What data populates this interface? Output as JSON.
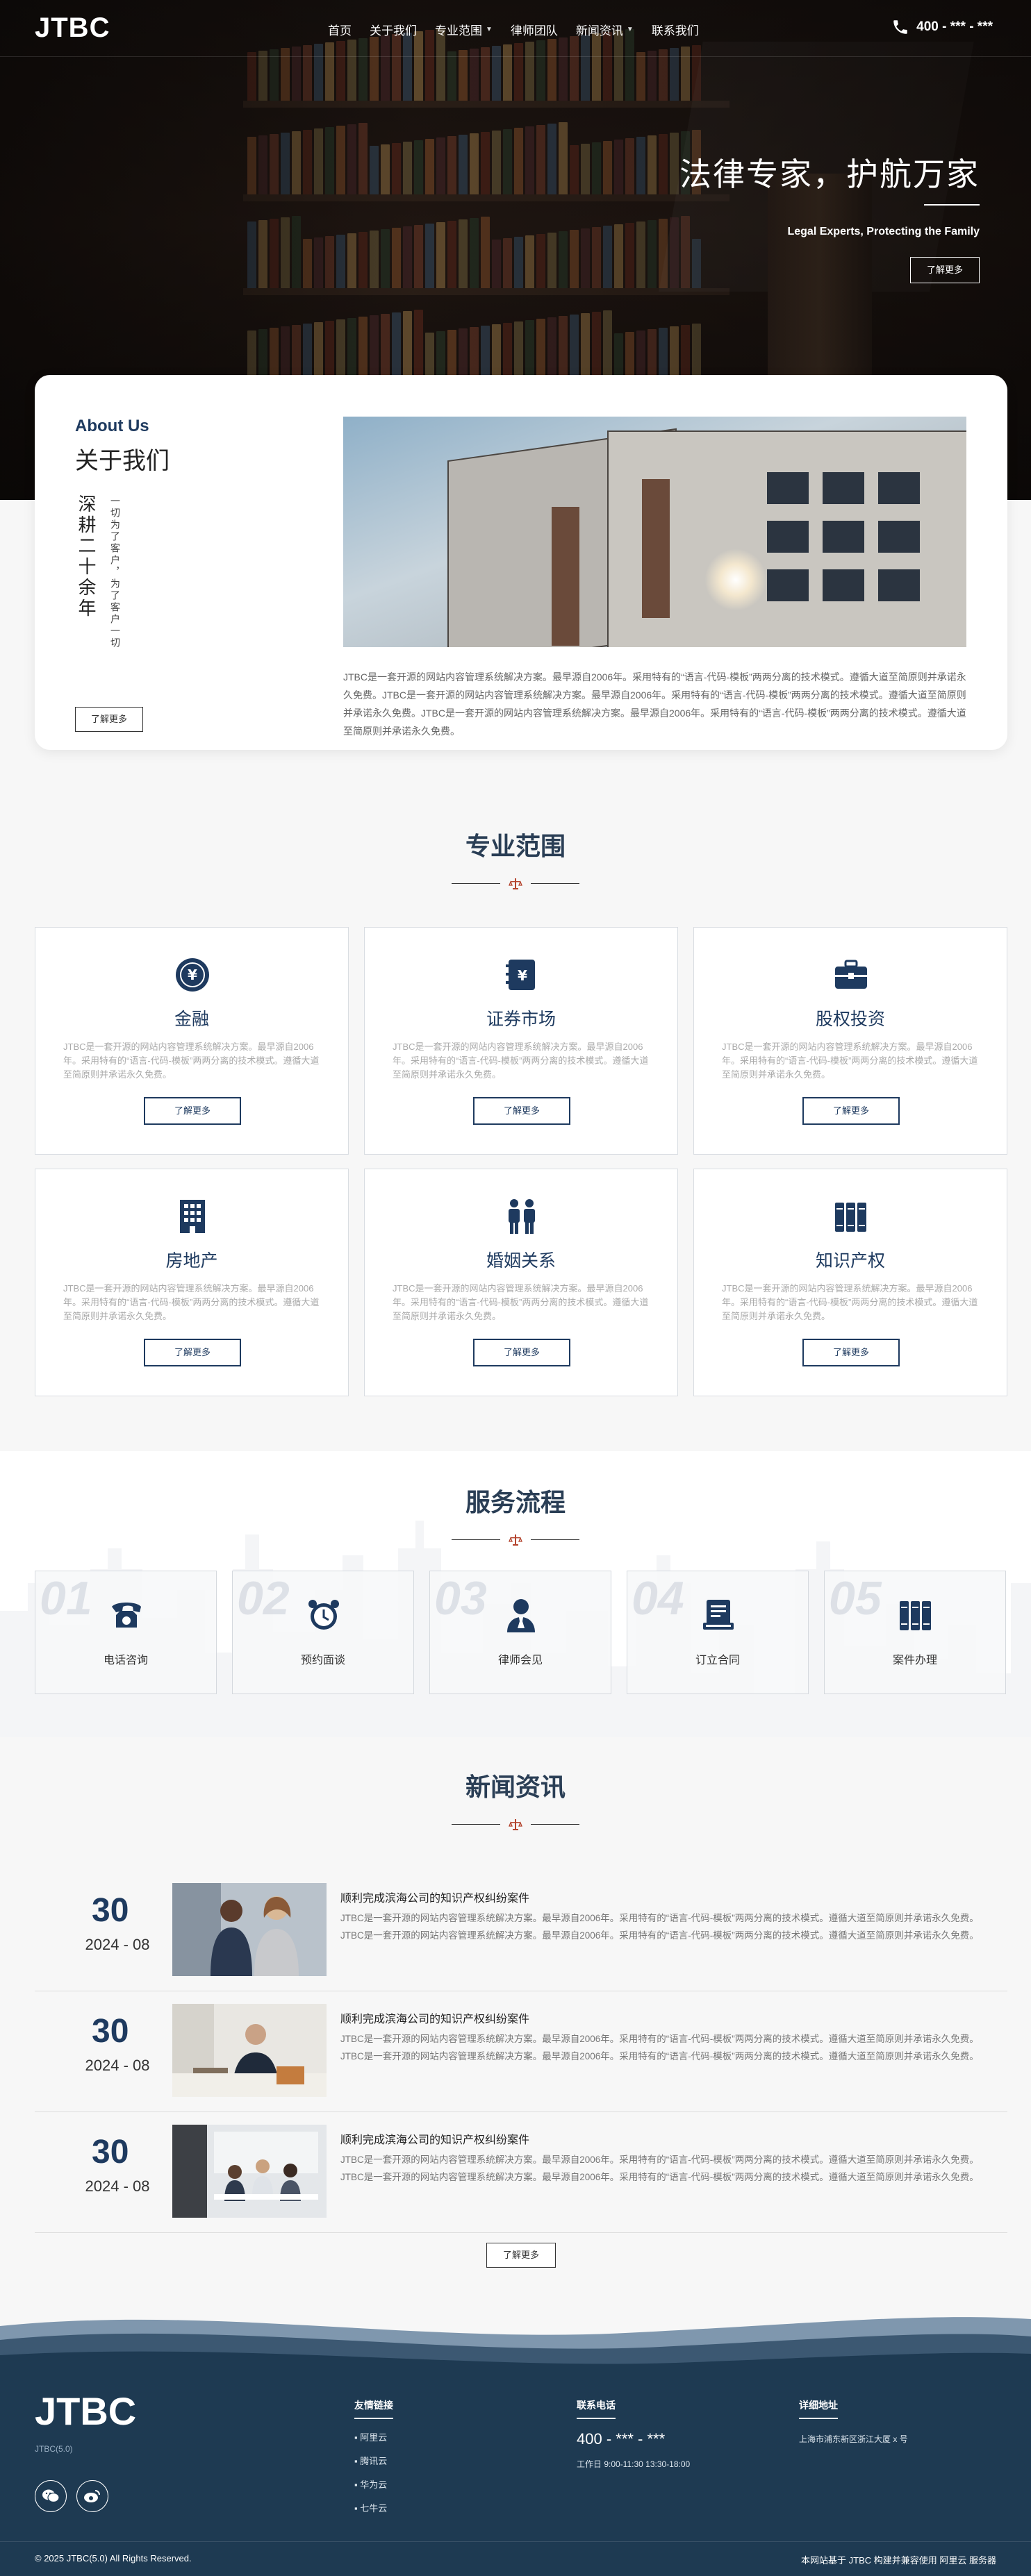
{
  "nav": {
    "logo": "JTBC",
    "items": [
      {
        "label": "首页"
      },
      {
        "label": "关于我们"
      },
      {
        "label": "专业范围"
      },
      {
        "label": "律师团队"
      },
      {
        "label": "新闻资讯"
      },
      {
        "label": "联系我们"
      }
    ],
    "phone": "400 - *** - ***"
  },
  "hero": {
    "title": "法律专家，护航万家",
    "subtitle": "Legal Experts, Protecting the Family",
    "button": "了解更多"
  },
  "about": {
    "en": "About Us",
    "cn": "关于我们",
    "vertical_big": "深耕二十余年",
    "vertical_small": "一切为了客户，为了客户一切",
    "button": "了解更多",
    "text": "JTBC是一套开源的网站内容管理系统解决方案。最早源自2006年。采用特有的“语言-代码-模板”两两分离的技术模式。遵循大道至简原则并承诺永久免费。JTBC是一套开源的网站内容管理系统解决方案。最早源自2006年。采用特有的“语言-代码-模板”两两分离的技术模式。遵循大道至简原则并承诺永久免费。JTBC是一套开源的网站内容管理系统解决方案。最早源自2006年。采用特有的“语言-代码-模板”两两分离的技术模式。遵循大道至简原则并承诺永久免费。"
  },
  "practice": {
    "title": "专业范围",
    "cards": [
      {
        "title": "金融",
        "icon": "yuan-coin-icon",
        "desc": "JTBC是一套开源的网站内容管理系统解决方案。最早源自2006年。采用特有的“语言-代码-模板”两两分离的技术模式。遵循大道至简原则并承诺永久免费。",
        "button": "了解更多"
      },
      {
        "title": "证券市场",
        "icon": "yuan-book-icon",
        "desc": "JTBC是一套开源的网站内容管理系统解决方案。最早源自2006年。采用特有的“语言-代码-模板”两两分离的技术模式。遵循大道至简原则并承诺永久免费。",
        "button": "了解更多"
      },
      {
        "title": "股权投资",
        "icon": "briefcase-icon",
        "desc": "JTBC是一套开源的网站内容管理系统解决方案。最早源自2006年。采用特有的“语言-代码-模板”两两分离的技术模式。遵循大道至简原则并承诺永久免费。",
        "button": "了解更多"
      },
      {
        "title": "房地产",
        "icon": "building-icon",
        "desc": "JTBC是一套开源的网站内容管理系统解决方案。最早源自2006年。采用特有的“语言-代码-模板”两两分离的技术模式。遵循大道至简原则并承诺永久免费。",
        "button": "了解更多"
      },
      {
        "title": "婚姻关系",
        "icon": "couple-icon",
        "desc": "JTBC是一套开源的网站内容管理系统解决方案。最早源自2006年。采用特有的“语言-代码-模板”两两分离的技术模式。遵循大道至简原则并承诺永久免费。",
        "button": "了解更多"
      },
      {
        "title": "知识产权",
        "icon": "books-icon",
        "desc": "JTBC是一套开源的网站内容管理系统解决方案。最早源自2006年。采用特有的“语言-代码-模板”两两分离的技术模式。遵循大道至简原则并承诺永久免费。",
        "button": "了解更多"
      }
    ]
  },
  "process": {
    "title": "服务流程",
    "steps": [
      {
        "num": "01",
        "label": "电话咨询",
        "icon": "telephone-icon"
      },
      {
        "num": "02",
        "label": "预约面谈",
        "icon": "alarm-clock-icon"
      },
      {
        "num": "03",
        "label": "律师会见",
        "icon": "lawyer-icon"
      },
      {
        "num": "04",
        "label": "订立合同",
        "icon": "contract-icon"
      },
      {
        "num": "05",
        "label": "案件办理",
        "icon": "case-files-icon"
      }
    ]
  },
  "news": {
    "title": "新闻资讯",
    "button": "了解更多",
    "items": [
      {
        "day": "30",
        "ym": "2024 - 08",
        "title": "顺利完成滨海公司的知识产权纠纷案件",
        "desc": "JTBC是一套开源的网站内容管理系统解决方案。最早源自2006年。采用特有的“语言-代码-模板”两两分离的技术模式。遵循大道至简原则并承诺永久免费。JTBC是一套开源的网站内容管理系统解决方案。最早源自2006年。采用特有的“语言-代码-模板”两两分离的技术模式。遵循大道至简原则并承诺永久免费。"
      },
      {
        "day": "30",
        "ym": "2024 - 08",
        "title": "顺利完成滨海公司的知识产权纠纷案件",
        "desc": "JTBC是一套开源的网站内容管理系统解决方案。最早源自2006年。采用特有的“语言-代码-模板”两两分离的技术模式。遵循大道至简原则并承诺永久免费。JTBC是一套开源的网站内容管理系统解决方案。最早源自2006年。采用特有的“语言-代码-模板”两两分离的技术模式。遵循大道至简原则并承诺永久免费。"
      },
      {
        "day": "30",
        "ym": "2024 - 08",
        "title": "顺利完成滨海公司的知识产权纠纷案件",
        "desc": "JTBC是一套开源的网站内容管理系统解决方案。最早源自2006年。采用特有的“语言-代码-模板”两两分离的技术模式。遵循大道至简原则并承诺永久免费。JTBC是一套开源的网站内容管理系统解决方案。最早源自2006年。采用特有的“语言-代码-模板”两两分离的技术模式。遵循大道至简原则并承诺永久免费。"
      }
    ]
  },
  "footer": {
    "logo": "JTBC",
    "sub": "JTBC(5.0)",
    "links_title": "友情链接",
    "links": [
      "阿里云",
      "腾讯云",
      "华为云",
      "七牛云"
    ],
    "phone_title": "联系电话",
    "phone": "400 - *** - ***",
    "hours": "工作日 9:00-11:30 13:30-18:00",
    "addr_title": "详细地址",
    "addr": "上海市浦东新区浙江大厦 x 号",
    "copyright": "© 2025 JTBC(5.0) All Rights Reserved.",
    "right": "本网站基于 JTBC 构建并兼容使用 阿里云 服务器"
  },
  "colors": {
    "primary": "#1e3a5f",
    "footer": "#1e3a52",
    "accent": "#b4442e"
  }
}
